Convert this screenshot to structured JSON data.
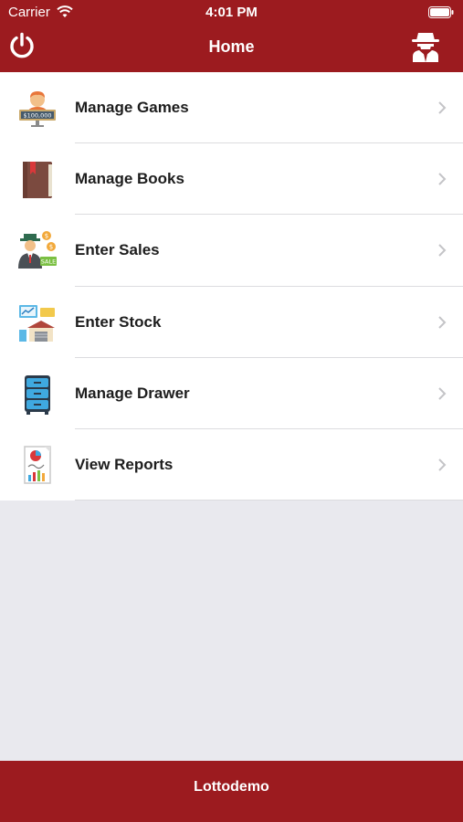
{
  "status_bar": {
    "carrier": "Carrier",
    "time": "4:01 PM"
  },
  "nav_bar": {
    "title": "Home",
    "left_icon": "power-icon",
    "right_icon": "spy-icon"
  },
  "menu": [
    {
      "label": "Manage Games",
      "icon": "games-icon"
    },
    {
      "label": "Manage Books",
      "icon": "book-icon"
    },
    {
      "label": "Enter Sales",
      "icon": "sales-icon"
    },
    {
      "label": "Enter Stock",
      "icon": "stock-icon"
    },
    {
      "label": "Manage Drawer",
      "icon": "drawer-icon"
    },
    {
      "label": "View Reports",
      "icon": "reports-icon"
    }
  ],
  "footer": {
    "label": "Lottodemo"
  },
  "colors": {
    "brand": "#9c1b1f",
    "background": "#e9e9ee"
  }
}
